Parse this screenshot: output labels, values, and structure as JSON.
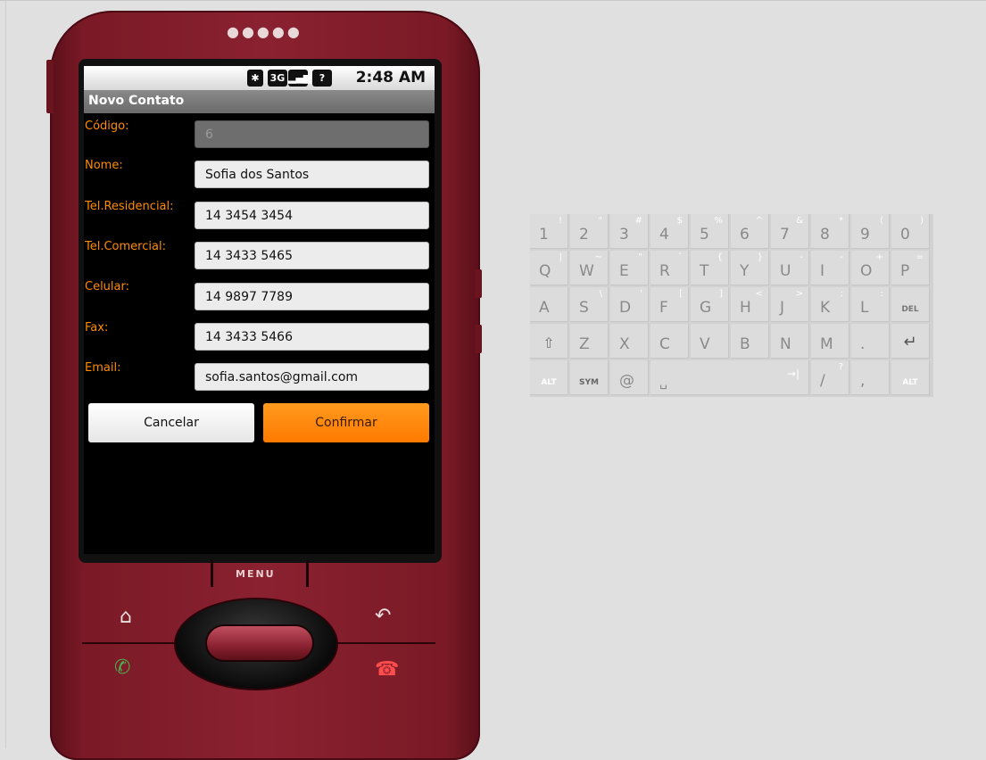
{
  "status": {
    "time": "2:48 AM"
  },
  "screen_title": "Novo Contato",
  "fields": [
    {
      "label": "Código:",
      "value": "6",
      "disabled": true
    },
    {
      "label": "Nome:",
      "value": "Sofia dos Santos"
    },
    {
      "label": "Tel.Residencial:",
      "value": "14 3454 3454"
    },
    {
      "label": "Tel.Comercial:",
      "value": "14 3433 5465"
    },
    {
      "label": "Celular:",
      "value": "14 9897 7789"
    },
    {
      "label": "Fax:",
      "value": "14 3433 5466"
    },
    {
      "label": "Email:",
      "value": "sofia.santos@gmail.com"
    }
  ],
  "buttons": {
    "cancel": "Cancelar",
    "confirm": "Confirmar"
  },
  "hardware": {
    "menu": "MENU"
  },
  "keyboard": {
    "row1": [
      [
        "1",
        "!"
      ],
      [
        "2",
        "\""
      ],
      [
        "3",
        "#"
      ],
      [
        "4",
        "$"
      ],
      [
        "5",
        "%"
      ],
      [
        "6",
        "^"
      ],
      [
        "7",
        "&"
      ],
      [
        "8",
        "*"
      ],
      [
        "9",
        "("
      ],
      [
        "0",
        ")"
      ]
    ],
    "row2": [
      [
        "Q",
        "|"
      ],
      [
        "W",
        "~"
      ],
      [
        "E",
        "\""
      ],
      [
        "R",
        "`"
      ],
      [
        "T",
        "{"
      ],
      [
        "Y",
        "}"
      ],
      [
        "U",
        "-"
      ],
      [
        "I",
        "-"
      ],
      [
        "O",
        "+"
      ],
      [
        "P",
        "="
      ]
    ],
    "row3": [
      [
        "A",
        ""
      ],
      [
        "S",
        "\\"
      ],
      [
        "D",
        "'"
      ],
      [
        "F",
        "["
      ],
      [
        "G",
        "]"
      ],
      [
        "H",
        "<"
      ],
      [
        "J",
        ">"
      ],
      [
        "K",
        ";"
      ],
      [
        "L",
        ":"
      ],
      [
        "DEL",
        ""
      ]
    ],
    "row4": [
      [
        "⇧",
        ""
      ],
      [
        "Z",
        ""
      ],
      [
        "X",
        ""
      ],
      [
        "C",
        ""
      ],
      [
        "V",
        ""
      ],
      [
        "B",
        ""
      ],
      [
        "N",
        ""
      ],
      [
        "M",
        ""
      ],
      [
        ".",
        ""
      ],
      [
        "↵",
        ""
      ]
    ],
    "row5": [
      [
        "ALT",
        ""
      ],
      [
        "SYM",
        ""
      ],
      [
        "@",
        ""
      ],
      [
        "␣",
        ""
      ],
      [
        "",
        ""
      ],
      [
        "→|",
        ""
      ],
      [
        "/",
        "?"
      ],
      [
        ",",
        ""
      ],
      [
        "ALT",
        ""
      ]
    ]
  },
  "colors": {
    "accent": "#ff8c00",
    "phone": "#7a1a26"
  }
}
